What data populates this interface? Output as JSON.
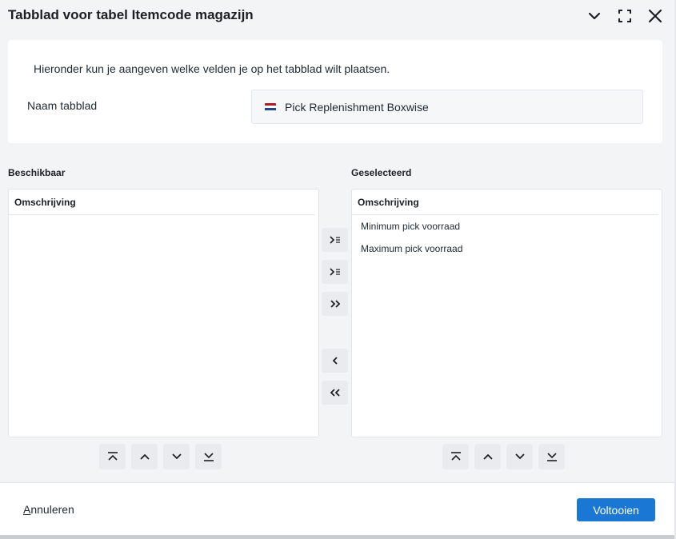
{
  "window": {
    "title": "Tabblad voor tabel Itemcode magazijn",
    "icons": [
      "chevron-down-icon",
      "maximize-icon",
      "close-icon"
    ]
  },
  "form": {
    "intro": "Hieronder kun je aangeven welke velden je op het tabblad wilt plaatsen.",
    "name_label": "Naam tabblad",
    "name_value": "Pick Replenishment Boxwise",
    "flag": "dutch-flag-icon"
  },
  "available": {
    "title": "Beschikbaar",
    "column_header": "Omschrijving",
    "items": []
  },
  "selected": {
    "title": "Geselecteerd",
    "column_header": "Omschrijving",
    "items": [
      "Minimum pick voorraad",
      "Maximum pick voorraad"
    ]
  },
  "transfer_buttons": [
    "move-selected-right-icon",
    "move-right-icon",
    "move-all-right-icon",
    "move-left-icon",
    "move-all-left-icon"
  ],
  "order_buttons": [
    "move-to-top-icon",
    "move-up-icon",
    "move-down-icon",
    "move-to-bottom-icon"
  ],
  "footer": {
    "cancel_first": "A",
    "cancel_rest": "nnuleren",
    "finish_label": "Voltooien"
  },
  "colors": {
    "primary": "#1a78d4",
    "background": "#f3f4f6",
    "flag_red": "#ae1c28",
    "flag_white": "#ffffff",
    "flag_blue": "#21468b"
  }
}
